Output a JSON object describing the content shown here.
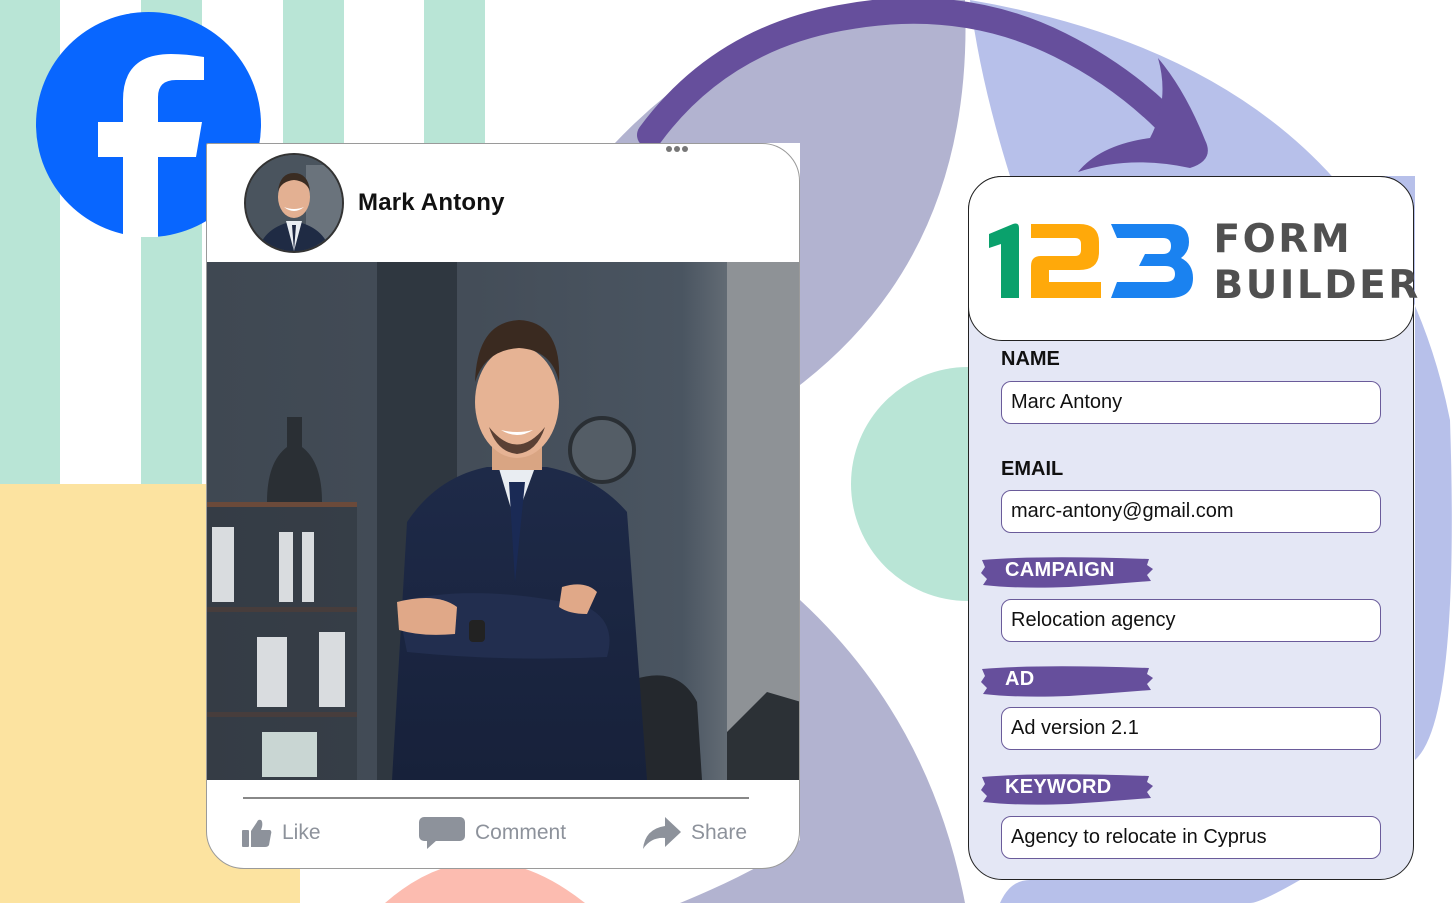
{
  "facebook_post": {
    "author_name": "Mark Antony",
    "more_options_icon": "more-horizontal-icon",
    "actions": [
      {
        "label": "Like",
        "icon": "thumbs-up-icon"
      },
      {
        "label": "Comment",
        "icon": "comment-icon"
      },
      {
        "label": "Share",
        "icon": "share-icon"
      }
    ]
  },
  "brand": {
    "facebook_logo": "facebook-icon",
    "facebook_color": "#0866ff"
  },
  "form": {
    "logo": {
      "digits": [
        "1",
        "2",
        "3"
      ],
      "line1": "FORM",
      "line2": "BUILDER",
      "colors": {
        "one": "#0aa16c",
        "two": "#ffa90a",
        "three": "#1a82f0"
      }
    },
    "fields": [
      {
        "label": "NAME",
        "value": "Marc Antony",
        "style": "plain"
      },
      {
        "label": "EMAIL",
        "value": "marc-antony@gmail.com",
        "style": "plain"
      },
      {
        "label": "CAMPAIGN",
        "value": "Relocation agency",
        "style": "highlighted"
      },
      {
        "label": "AD",
        "value": "Ad version 2.1",
        "style": "highlighted"
      },
      {
        "label": "KEYWORD",
        "value": "Agency to relocate in Cyprus",
        "style": "highlighted"
      }
    ],
    "highlight_color": "#664f9c"
  },
  "decor": {
    "arrow_color": "#664f9c",
    "mint": "#b9e5d6",
    "yellow": "#fce3a0",
    "lavender": "#b2b3d0",
    "periwinkle": "#b7c0ea",
    "salmon": "#fcbcb0"
  }
}
